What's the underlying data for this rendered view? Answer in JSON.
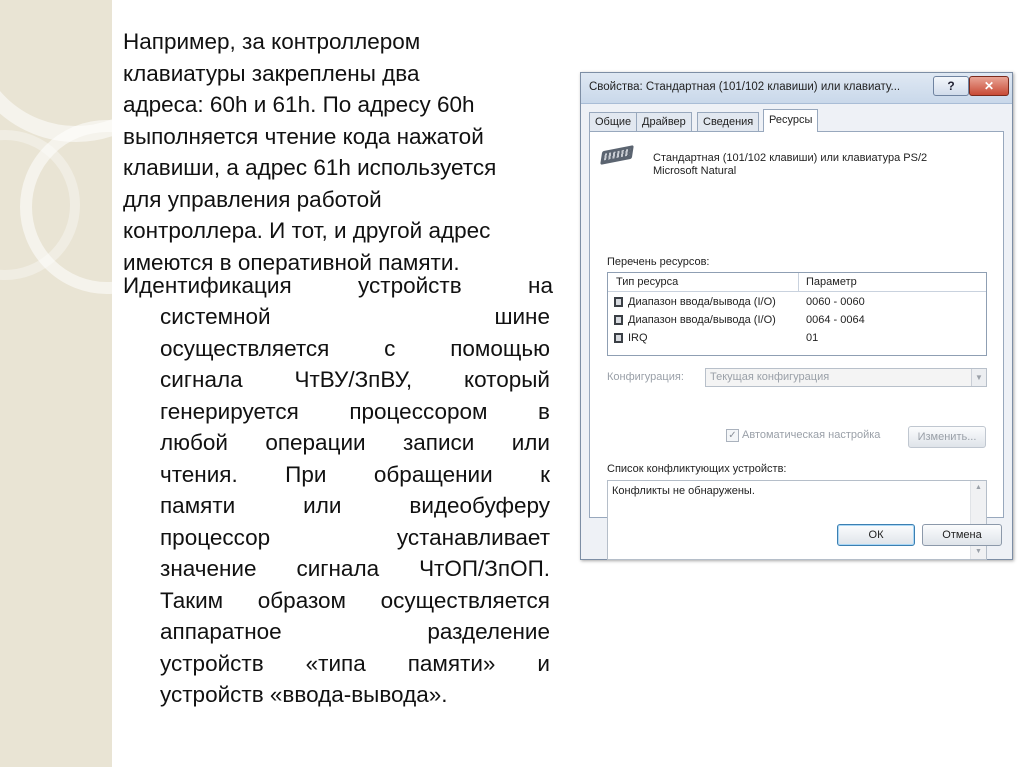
{
  "slide": {
    "paragraph1": [
      "Например, за контроллером",
      "клавиатуры закреплены два",
      "адреса: 60h и 61h. По адресу 60h",
      "выполняется чтение кода нажатой",
      "клавиши, а адрес 61h используется",
      "для управления работой",
      "контроллера. И тот, и другой адрес",
      "имеются в оперативной памяти."
    ],
    "paragraph2_first": "Идентификация устройств на",
    "paragraph2_rest": [
      "системной шине",
      "осуществляется с помощью",
      "сигнала ЧтВУ/ЗпВУ, который",
      "генерируется процессором в",
      "любой операции записи или",
      "чтения. При обращении к",
      "памяти или видеобуферу",
      "процессор устанавливает",
      "значение сигнала ЧтОП/ЗпОП.",
      "Таким образом осуществляется",
      "аппаратное разделение",
      "устройств «типа памяти» и",
      "устройств «ввода-вывода»."
    ]
  },
  "dialog": {
    "title": "Свойства: Стандартная (101/102 клавиши) или клавиату...",
    "help_label": "?",
    "close_label": "✕",
    "tabs": [
      "Общие",
      "Драйвер",
      "Сведения",
      "Ресурсы"
    ],
    "device_name_1": "Стандартная (101/102 клавиши) или клавиатура PS/2",
    "device_name_2": "Microsoft Natural",
    "resources_label": "Перечень ресурсов:",
    "col_type": "Тип ресурса",
    "col_param": "Параметр",
    "rows": [
      {
        "type": "Диапазон ввода/вывода (I/O)",
        "param": "0060 - 0060"
      },
      {
        "type": "Диапазон ввода/вывода (I/O)",
        "param": "0064 - 0064"
      },
      {
        "type": "IRQ",
        "param": "01"
      }
    ],
    "config_label": "Конфигурация:",
    "config_value": "Текущая конфигурация",
    "auto_label": "Автоматическая настройка",
    "change_button": "Изменить...",
    "conflicts_label": "Список конфликтующих устройств:",
    "conflicts_text": "Конфликты не обнаружены.",
    "ok_button": "ОК",
    "cancel_button": "Отмена"
  }
}
